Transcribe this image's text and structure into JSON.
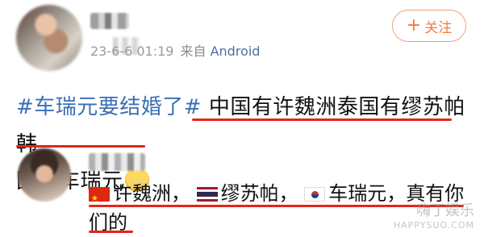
{
  "author": {
    "meta_date": "23-6-6 01:19",
    "meta_from": "来自",
    "meta_client": "Android"
  },
  "follow_button": {
    "label": "关注",
    "icon": "plus-icon"
  },
  "post": {
    "hashtag": "#车瑞元要结婚了#",
    "text_line1": "中国有许魏洲泰国有缪苏帕韩",
    "text_line2": "国有车瑞元",
    "emoji": "shy-face-emoji"
  },
  "reply": {
    "seg1": "许魏洲，",
    "seg2": "缪苏帕，",
    "seg3": "车瑞元，真有你",
    "seg4": "们的"
  },
  "watermark": {
    "cn": "嗨丁娱乐",
    "en": "HAPPYSUO.COM"
  },
  "colors": {
    "hashtag": "#3b6fb6",
    "underline": "#e3261a",
    "follow": "#f07d3d",
    "client": "#4a6fa5"
  }
}
